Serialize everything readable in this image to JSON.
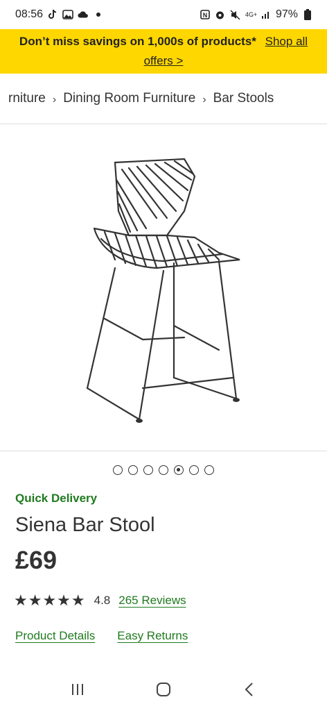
{
  "status_bar": {
    "time": "08:56",
    "battery": "97%",
    "network": "4G+",
    "left_icons": [
      "tiktok-icon",
      "image-icon",
      "cloud-icon",
      "dot-icon"
    ],
    "right_icons": [
      "nfc-icon",
      "alarm-icon",
      "mute-icon",
      "signal-icon",
      "battery-icon"
    ]
  },
  "promo": {
    "text": "Don’t miss savings on 1,000s of products*",
    "link": "Shop all offers >",
    "background": "#ffd700"
  },
  "breadcrumb": {
    "items": [
      "rniture",
      "Dining Room Furniture",
      "Bar Stools"
    ],
    "separator": "›"
  },
  "gallery": {
    "dots_count": 7,
    "active_index": 4
  },
  "product": {
    "delivery_label": "Quick Delivery",
    "title": "Siena Bar Stool",
    "price": "£69",
    "stars": "★★★★★",
    "rating": "4.8",
    "reviews_link": "265 Reviews",
    "details_link": "Product Details",
    "returns_link": "Easy Returns"
  },
  "colors": {
    "accent_green": "#1f7a1f",
    "text": "#333333"
  }
}
